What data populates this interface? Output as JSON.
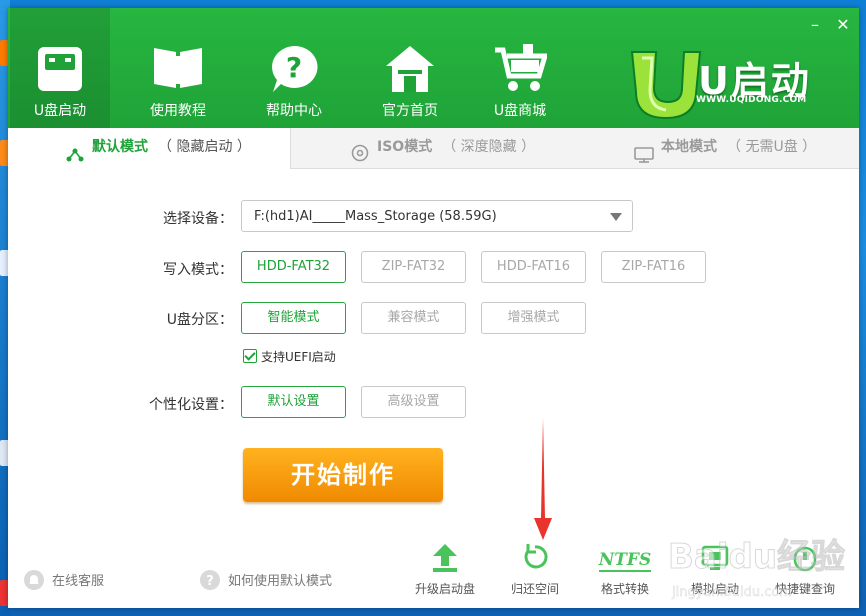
{
  "window": {
    "minimize_glyph": "–",
    "close_glyph": "✕"
  },
  "nav": [
    {
      "label": "U盘启动",
      "icon": "usb-drive-icon",
      "active": true
    },
    {
      "label": "使用教程",
      "icon": "book-icon",
      "active": false
    },
    {
      "label": "帮助中心",
      "icon": "question-bubble-icon",
      "active": false
    },
    {
      "label": "官方首页",
      "icon": "home-icon",
      "active": false
    },
    {
      "label": "U盘商城",
      "icon": "shopping-cart-icon",
      "active": false
    }
  ],
  "brand": {
    "logo_text": "U启动",
    "url": "WWW.UQIDONG.COM"
  },
  "tabs": [
    {
      "title": "默认模式",
      "subtitle": "（ 隐藏启动 ）",
      "icon": "share-nodes-icon",
      "active": true
    },
    {
      "title": "ISO模式",
      "subtitle": "（ 深度隐藏 ）",
      "icon": "disc-icon",
      "active": false
    },
    {
      "title": "本地模式",
      "subtitle": "（ 无需U盘 ）",
      "icon": "monitor-icon",
      "active": false
    }
  ],
  "form": {
    "device_label": "选择设备：",
    "device_value": "F:(hd1)AI_____Mass_Storage (58.59G)",
    "write_label": "写入模式：",
    "write_options": [
      "HDD-FAT32",
      "ZIP-FAT32",
      "HDD-FAT16",
      "ZIP-FAT16"
    ],
    "write_selected": 0,
    "partition_label": "U盘分区：",
    "partition_options": [
      "智能模式",
      "兼容模式",
      "增强模式"
    ],
    "partition_selected": 0,
    "uefi_label": "支持UEFI启动",
    "uefi_checked": true,
    "custom_label": "个性化设置：",
    "custom_options": [
      "默认设置",
      "高级设置"
    ],
    "custom_selected": 0,
    "start_label": "开始制作"
  },
  "footer": {
    "links": [
      {
        "label": "在线客服",
        "icon": "bell-icon"
      },
      {
        "label": "如何使用默认模式",
        "icon": "question-icon"
      }
    ],
    "tools": [
      {
        "label": "升级启动盘",
        "icon": "upload-arrow-icon"
      },
      {
        "label": "归还空间",
        "icon": "restore-icon"
      },
      {
        "label": "格式转换",
        "icon": "ntfs-icon",
        "icon_text": "NTFS"
      },
      {
        "label": "模拟启动",
        "icon": "simulate-icon"
      },
      {
        "label": "快捷键查询",
        "icon": "key-icon"
      }
    ]
  },
  "watermark": {
    "text": "Baidu经验",
    "url": "jingyan.baidu.com"
  },
  "colors": {
    "brand_green": "#1fa338",
    "accent_orange": "#f08a00",
    "annotation_red": "#e8342c"
  }
}
